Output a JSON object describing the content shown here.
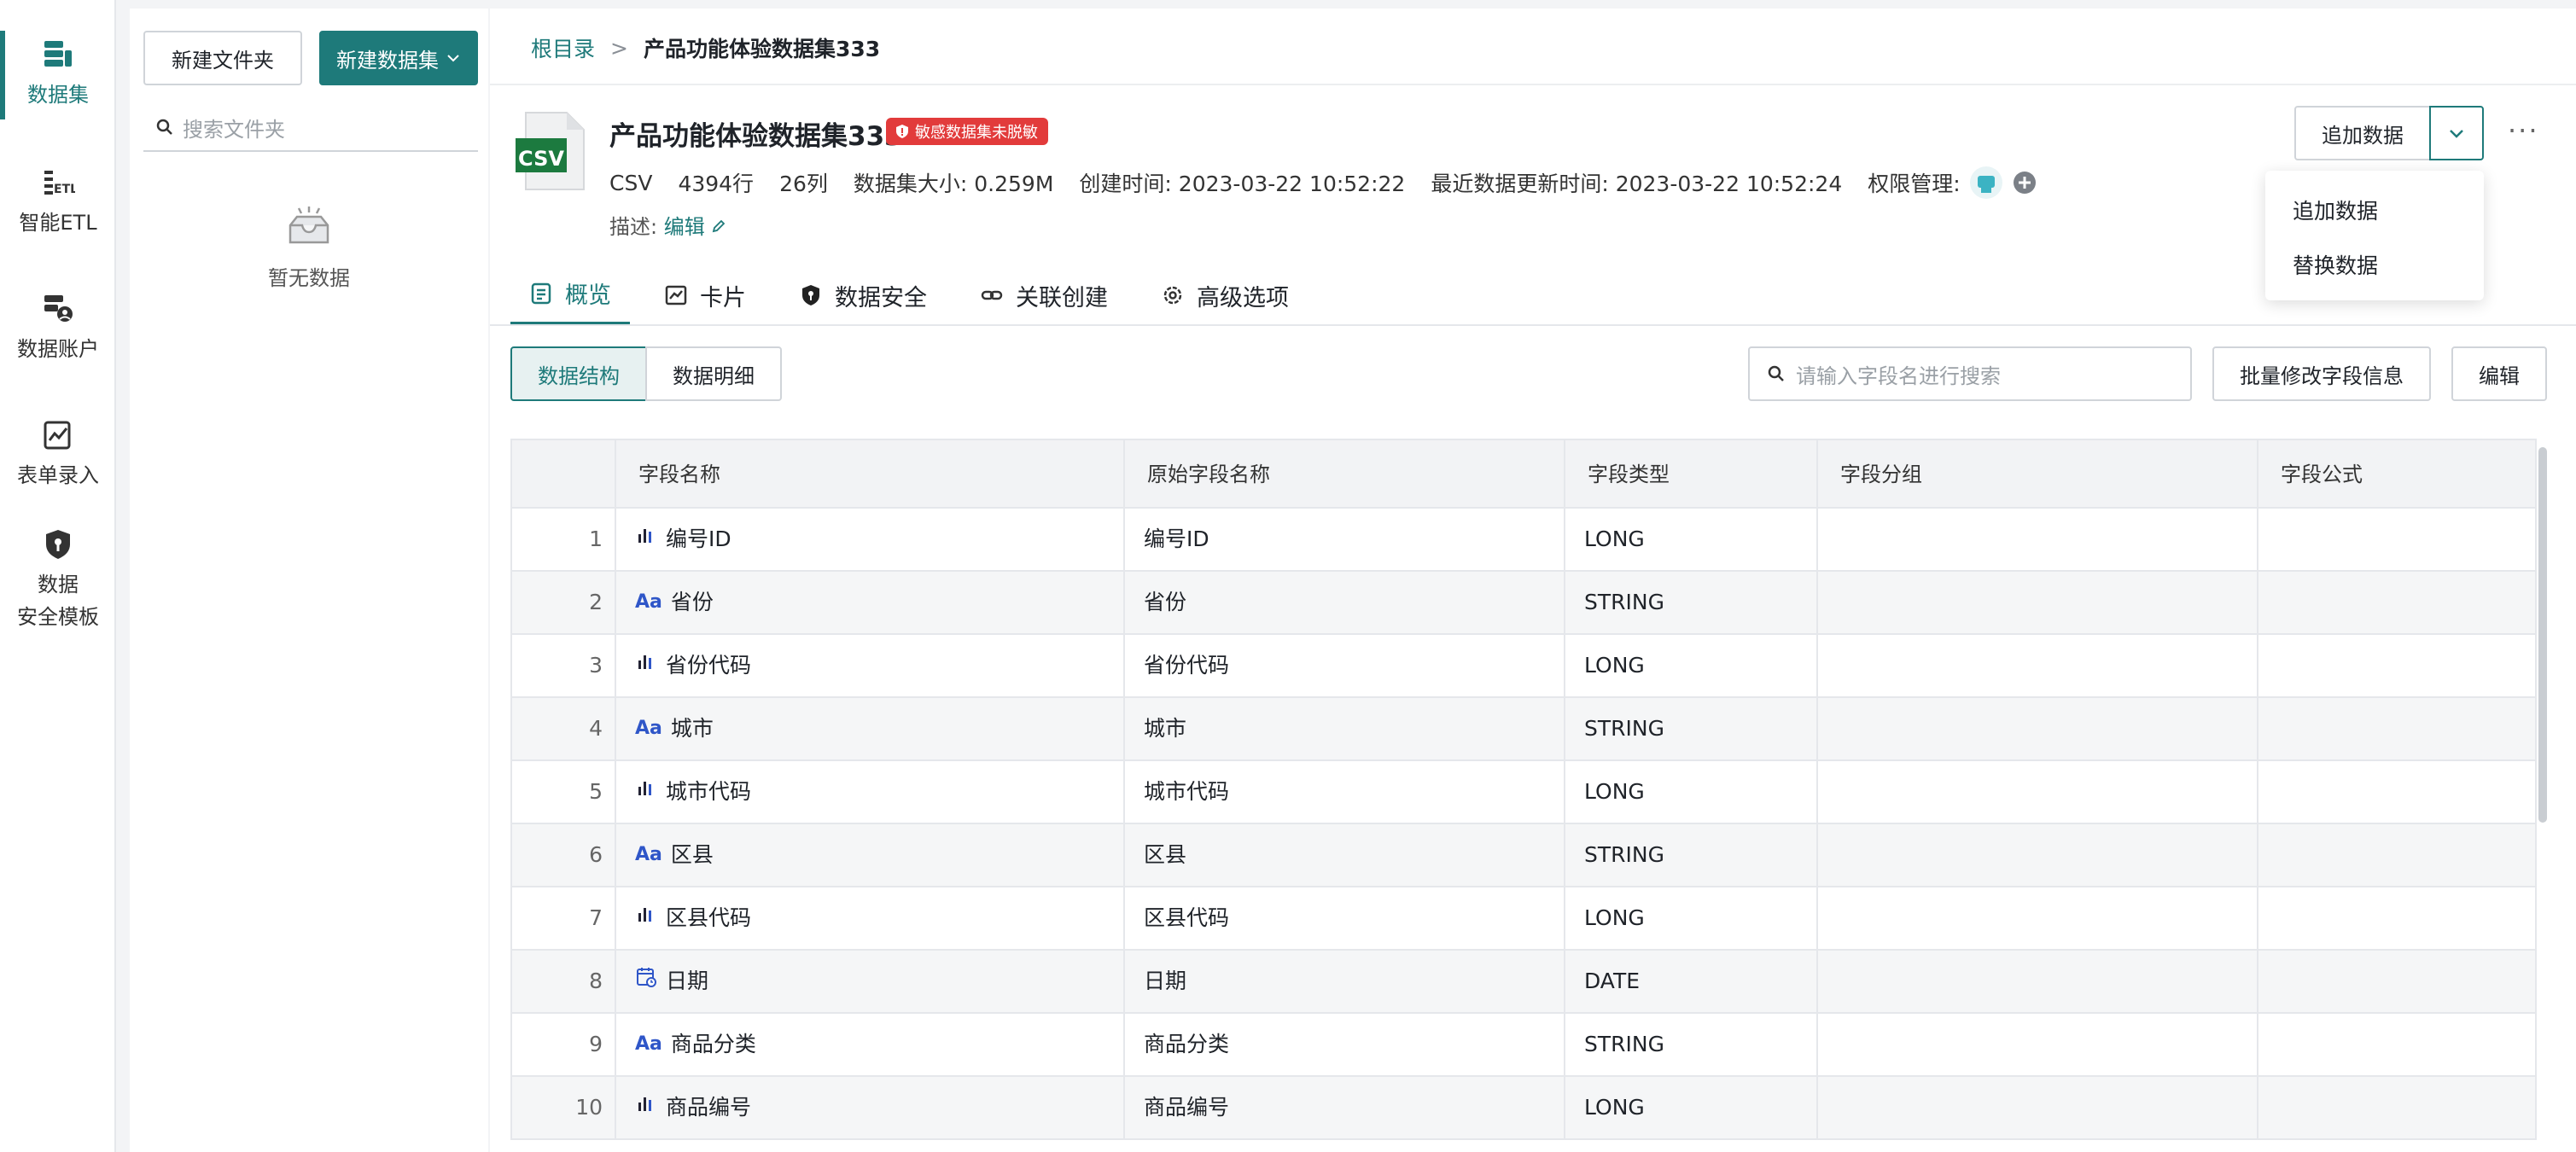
{
  "rail": {
    "items": [
      {
        "label": "数据集",
        "icon": "dataset-icon",
        "active": true
      },
      {
        "label": "智能ETL",
        "icon": "etl-icon"
      },
      {
        "label": "数据账户",
        "icon": "data-account-icon"
      },
      {
        "label": "表单录入",
        "icon": "form-entry-icon"
      },
      {
        "label_line1": "数据",
        "label_line2": "安全模板",
        "icon": "shield-template-icon"
      }
    ]
  },
  "folder_panel": {
    "new_folder": "新建文件夹",
    "new_dataset": "新建数据集",
    "search_placeholder": "搜索文件夹",
    "empty_text": "暂无数据"
  },
  "breadcrumb": {
    "root": "根目录",
    "sep": ">",
    "current": "产品功能体验数据集333"
  },
  "dataset": {
    "icon_text": "CSV",
    "title": "产品功能体验数据集333",
    "badge": "敏感数据集未脱敏",
    "meta": {
      "type": "CSV",
      "rows": "4394行",
      "cols": "26列",
      "size_label": "数据集大小:",
      "size": "0.259M",
      "created_label": "创建时间:",
      "created": "2023-03-22 10:52:22",
      "updated_label": "最近数据更新时间:",
      "updated": "2023-03-22 10:52:24",
      "perm_label": "权限管理:"
    },
    "desc_label": "描述:",
    "desc_edit": "编辑"
  },
  "actions": {
    "append": "追加数据",
    "more": "···",
    "dropdown": [
      "追加数据",
      "替换数据"
    ]
  },
  "tabs": [
    {
      "label": "概览",
      "icon": "overview-icon",
      "active": true
    },
    {
      "label": "卡片",
      "icon": "card-icon"
    },
    {
      "label": "数据安全",
      "icon": "security-icon"
    },
    {
      "label": "关联创建",
      "icon": "link-icon"
    },
    {
      "label": "高级选项",
      "icon": "settings-icon"
    }
  ],
  "toolbar": {
    "seg_structure": "数据结构",
    "seg_detail": "数据明细",
    "field_search_placeholder": "请输入字段名进行搜索",
    "batch_edit": "批量修改字段信息",
    "edit": "编辑"
  },
  "table": {
    "headers": [
      "字段名称",
      "原始字段名称",
      "字段类型",
      "字段分组",
      "字段公式"
    ],
    "rows": [
      {
        "idx": "1",
        "kind": "number",
        "name": "编号ID",
        "orig": "编号ID",
        "type": "LONG"
      },
      {
        "idx": "2",
        "kind": "text",
        "name": "省份",
        "orig": "省份",
        "type": "STRING"
      },
      {
        "idx": "3",
        "kind": "number",
        "name": "省份代码",
        "orig": "省份代码",
        "type": "LONG"
      },
      {
        "idx": "4",
        "kind": "text",
        "name": "城市",
        "orig": "城市",
        "type": "STRING"
      },
      {
        "idx": "5",
        "kind": "number",
        "name": "城市代码",
        "orig": "城市代码",
        "type": "LONG"
      },
      {
        "idx": "6",
        "kind": "text",
        "name": "区县",
        "orig": "区县",
        "type": "STRING"
      },
      {
        "idx": "7",
        "kind": "number",
        "name": "区县代码",
        "orig": "区县代码",
        "type": "LONG"
      },
      {
        "idx": "8",
        "kind": "date",
        "name": "日期",
        "orig": "日期",
        "type": "DATE"
      },
      {
        "idx": "9",
        "kind": "text",
        "name": "商品分类",
        "orig": "商品分类",
        "type": "STRING"
      },
      {
        "idx": "10",
        "kind": "number",
        "name": "商品编号",
        "orig": "商品编号",
        "type": "LONG"
      }
    ],
    "text_type_glyph": "Aa"
  },
  "colors": {
    "accent": "#1e7a7a",
    "badge": "#e23b3b",
    "type_icon": "#2f56c8"
  }
}
